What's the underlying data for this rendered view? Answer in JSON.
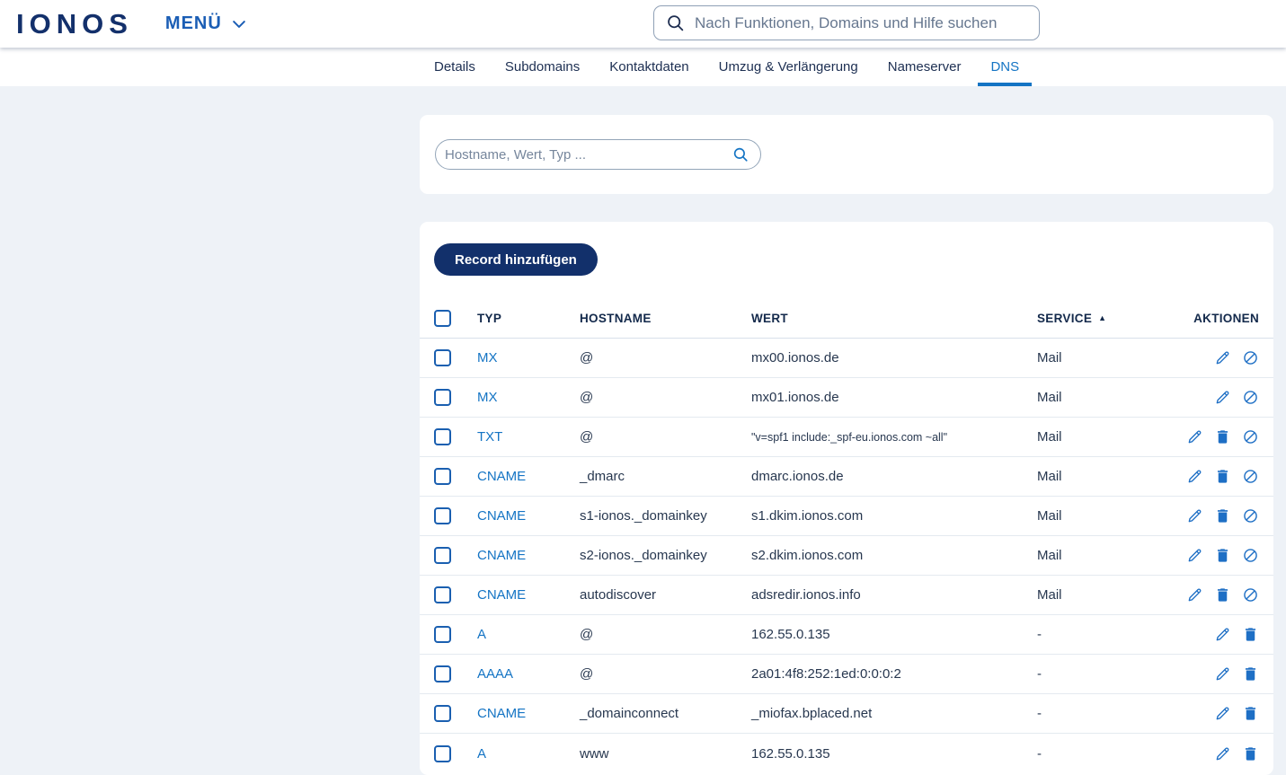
{
  "header": {
    "logo": "IONOS",
    "menu_label": "MENÜ",
    "search_placeholder": "Nach Funktionen, Domains und Hilfe suchen"
  },
  "tabs": [
    {
      "label": "Details",
      "active": false
    },
    {
      "label": "Subdomains",
      "active": false
    },
    {
      "label": "Kontaktdaten",
      "active": false
    },
    {
      "label": "Umzug & Verlängerung",
      "active": false
    },
    {
      "label": "Nameserver",
      "active": false
    },
    {
      "label": "DNS",
      "active": true
    }
  ],
  "filter": {
    "placeholder": "Hostname, Wert, Typ ...",
    "value": ""
  },
  "records": {
    "add_button_label": "Record hinzufügen",
    "columns": {
      "typ": "TYP",
      "hostname": "HOSTNAME",
      "wert": "WERT",
      "service": "SERVICE",
      "aktionen": "AKTIONEN"
    },
    "sort": {
      "column": "SERVICE",
      "direction": "asc",
      "arrow": "▲"
    },
    "rows": [
      {
        "typ": "MX",
        "hostname": "@",
        "wert": "mx00.ionos.de",
        "service": "Mail",
        "small": false,
        "actions": [
          "edit",
          "disable"
        ]
      },
      {
        "typ": "MX",
        "hostname": "@",
        "wert": "mx01.ionos.de",
        "service": "Mail",
        "small": false,
        "actions": [
          "edit",
          "disable"
        ]
      },
      {
        "typ": "TXT",
        "hostname": "@",
        "wert": "\"v=spf1 include:_spf-eu.ionos.com ~all\"",
        "service": "Mail",
        "small": true,
        "actions": [
          "edit",
          "delete",
          "disable"
        ]
      },
      {
        "typ": "CNAME",
        "hostname": "_dmarc",
        "wert": "dmarc.ionos.de",
        "service": "Mail",
        "small": false,
        "actions": [
          "edit",
          "delete",
          "disable"
        ]
      },
      {
        "typ": "CNAME",
        "hostname": "s1-ionos._domainkey",
        "wert": "s1.dkim.ionos.com",
        "service": "Mail",
        "small": false,
        "actions": [
          "edit",
          "delete",
          "disable"
        ]
      },
      {
        "typ": "CNAME",
        "hostname": "s2-ionos._domainkey",
        "wert": "s2.dkim.ionos.com",
        "service": "Mail",
        "small": false,
        "actions": [
          "edit",
          "delete",
          "disable"
        ]
      },
      {
        "typ": "CNAME",
        "hostname": "autodiscover",
        "wert": "adsredir.ionos.info",
        "service": "Mail",
        "small": false,
        "actions": [
          "edit",
          "delete",
          "disable"
        ]
      },
      {
        "typ": "A",
        "hostname": "@",
        "wert": "162.55.0.135",
        "service": "-",
        "small": false,
        "actions": [
          "edit",
          "delete"
        ]
      },
      {
        "typ": "AAAA",
        "hostname": "@",
        "wert": "2a01:4f8:252:1ed:0:0:0:2",
        "service": "-",
        "small": false,
        "actions": [
          "edit",
          "delete"
        ]
      },
      {
        "typ": "CNAME",
        "hostname": "_domainconnect",
        "wert": "_miofax.bplaced.net",
        "service": "-",
        "small": false,
        "actions": [
          "edit",
          "delete"
        ]
      },
      {
        "typ": "A",
        "hostname": "www",
        "wert": "162.55.0.135",
        "service": "-",
        "small": false,
        "actions": [
          "edit",
          "delete"
        ]
      }
    ]
  },
  "colors": {
    "brand_navy": "#13306b",
    "link_blue": "#1474c4",
    "icon_blue": "#1e6fc5",
    "button_navy": "#12306b",
    "page_background": "#eef2f7",
    "text_dark": "#27374f"
  }
}
